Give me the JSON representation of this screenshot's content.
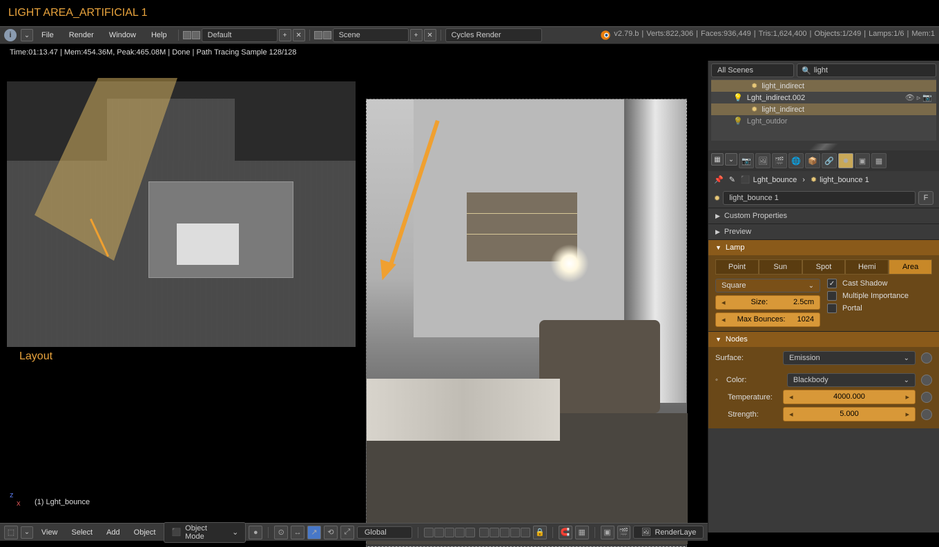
{
  "title": "LIGHT AREA_ARTIFICIAL 1",
  "menu": {
    "file": "File",
    "render": "Render",
    "window": "Window",
    "help": "Help",
    "layout_preset": "Default",
    "scene": "Scene",
    "engine": "Cycles Render"
  },
  "stats": {
    "version": "v2.79.b",
    "verts": "Verts:822,306",
    "faces": "Faces:936,449",
    "tris": "Tris:1,624,400",
    "objects": "Objects:1/249",
    "lamps": "Lamps:1/6",
    "mem": "Mem:1"
  },
  "render_status": "Time:01:13.47 | Mem:454.36M, Peak:465.08M | Done | Path Tracing Sample 128/128",
  "layout_label": "Layout",
  "active_object": "(1) Lght_bounce",
  "axis": {
    "z": "z",
    "x": "x"
  },
  "bottom": {
    "view": "View",
    "select": "Select",
    "add": "Add",
    "object": "Object",
    "mode": "Object Mode",
    "orientation": "Global",
    "layer": "RenderLaye"
  },
  "outliner": {
    "scope": "All Scenes",
    "search": "light",
    "items": [
      {
        "label": "light_indirect",
        "indent": 2,
        "active": true
      },
      {
        "label": "Lght_indirect.002",
        "indent": 1,
        "active": false
      },
      {
        "label": "light_indirect",
        "indent": 2,
        "active": true
      },
      {
        "label": "Lght_outdor",
        "indent": 1,
        "active": false
      }
    ]
  },
  "breadcrumb": {
    "obj": "Lght_bounce",
    "data": "light_bounce 1"
  },
  "datablock": {
    "name": "light_bounce 1",
    "fake": "F"
  },
  "panels": {
    "custom": "Custom Properties",
    "preview": "Preview",
    "lamp": "Lamp",
    "nodes": "Nodes"
  },
  "lamp": {
    "tabs": {
      "point": "Point",
      "sun": "Sun",
      "spot": "Spot",
      "hemi": "Hemi",
      "area": "Area"
    },
    "shape": "Square",
    "size_label": "Size:",
    "size_value": "2.5cm",
    "bounces_label": "Max Bounces:",
    "bounces_value": "1024",
    "cast_shadow": "Cast Shadow",
    "multi_importance": "Multiple Importance",
    "portal": "Portal"
  },
  "nodes": {
    "surface_label": "Surface:",
    "surface_value": "Emission",
    "color_label": "Color:",
    "color_value": "Blackbody",
    "temp_label": "Temperature:",
    "temp_value": "4000.000",
    "strength_label": "Strength:",
    "strength_value": "5.000"
  }
}
